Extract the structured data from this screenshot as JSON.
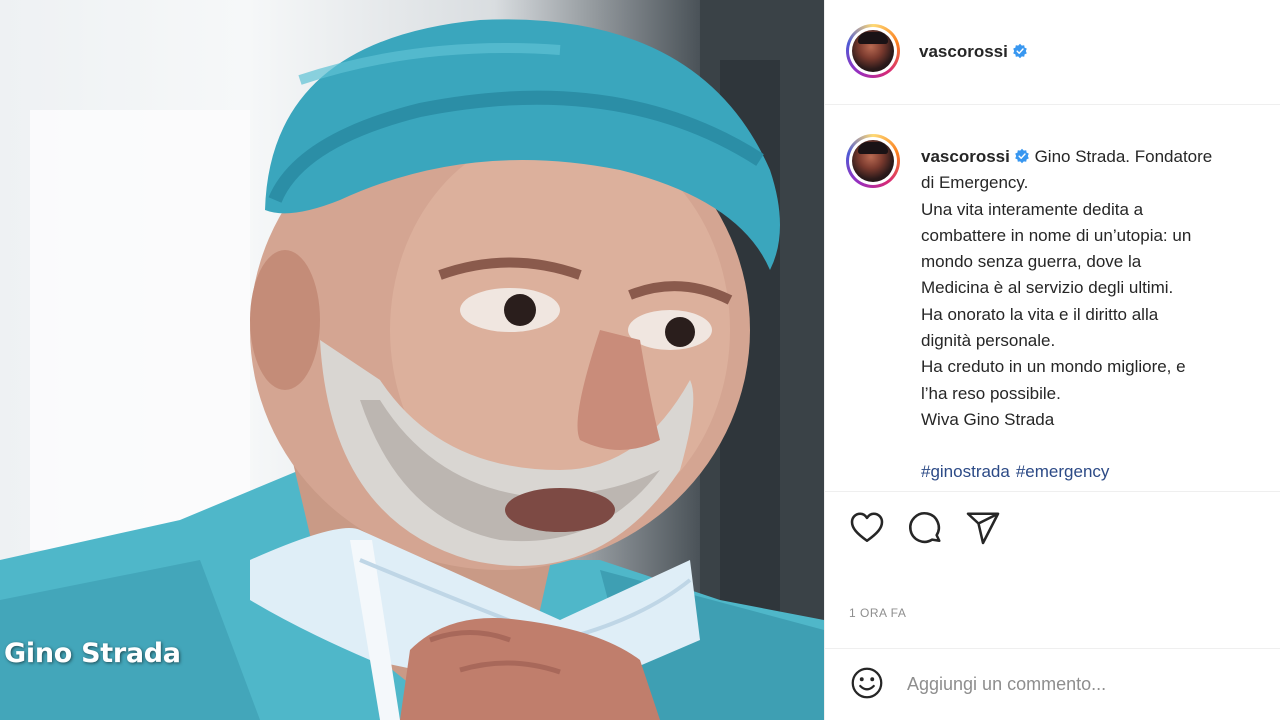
{
  "post": {
    "username": "vascorossi",
    "verified": true,
    "image_watermark": "Gino Strada",
    "caption_lines": [
      "Gino Strada. Fondatore",
      "di Emergency.",
      "Una vita interamente dedita a",
      "combattere in nome di un’utopia: un",
      "mondo senza guerra, dove la",
      "Medicina è al servizio degli ultimi.",
      "Ha onorato la vita e il diritto alla",
      "dignità personale.",
      "Ha creduto in un mondo migliore, e",
      "l’ha reso possibile.",
      "Wiva Gino Strada"
    ],
    "hashtags": [
      "#ginostrada",
      "#emergency"
    ],
    "timestamp": "1 ORA FA"
  },
  "comment": {
    "placeholder": "Aggiungi un commento..."
  },
  "icons": {
    "like": "heart-icon",
    "comment": "comment-icon",
    "share": "send-icon",
    "emoji": "emoji-icon",
    "verified": "verified-badge-icon"
  },
  "colors": {
    "verified": "#3897f0",
    "hashtag": "#2c4a86",
    "muted": "#8e8e8e",
    "text": "#262626"
  }
}
